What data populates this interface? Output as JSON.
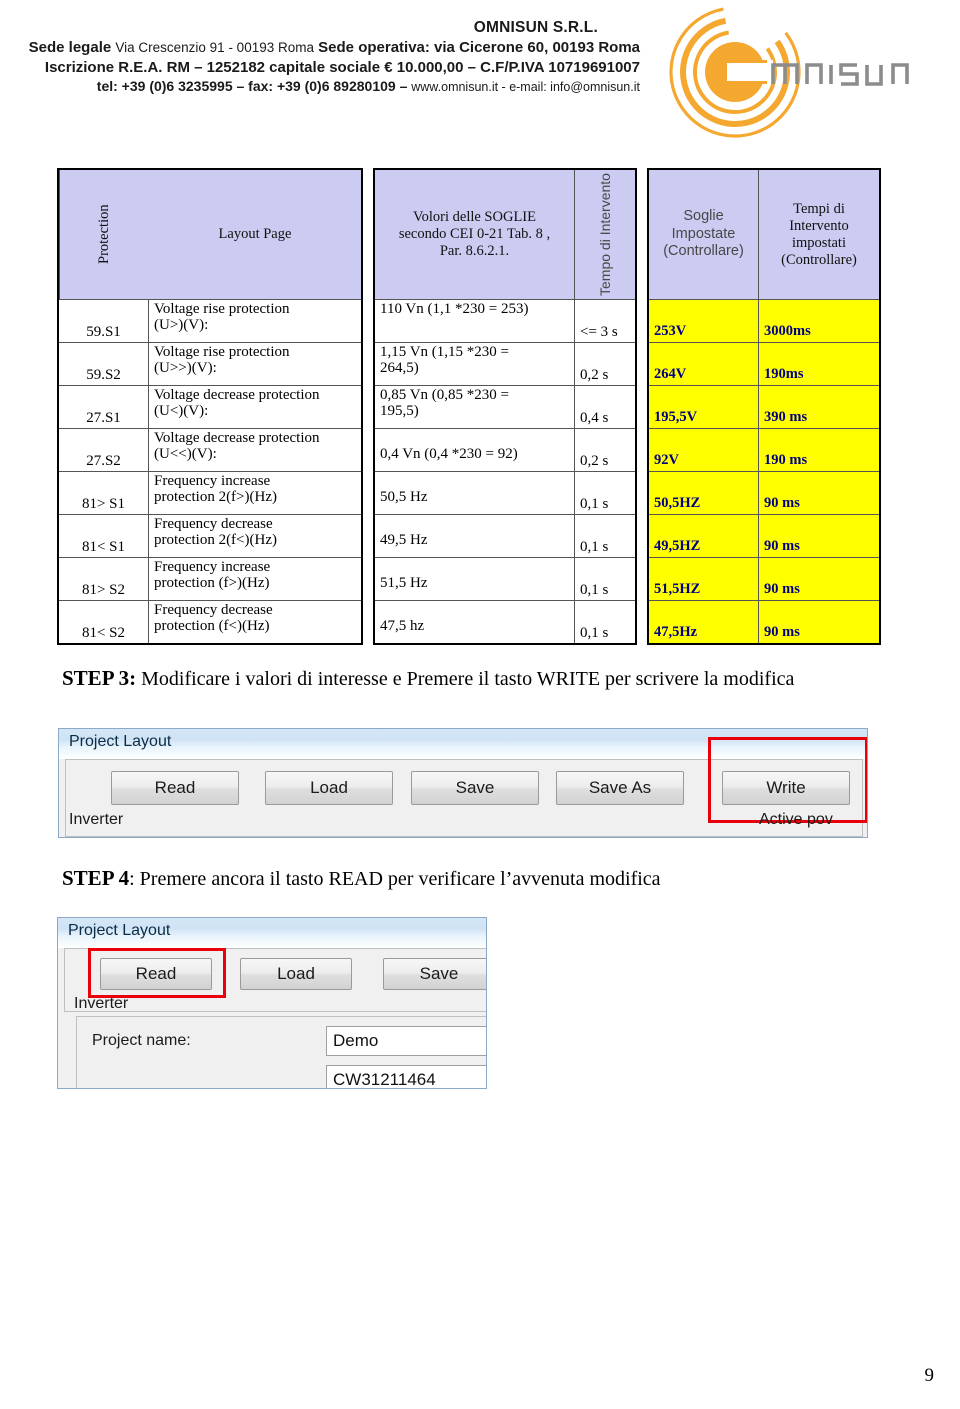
{
  "letterhead": {
    "company": "OMNISUN S.R.L.",
    "line2_bold_a": "Sede legale",
    "line2_thin": "Via Crescenzio 91 - 00193 Roma",
    "line2_bold_b": "Sede operativa: via Cicerone 60, 00193 Roma",
    "line3": "Iscrizione R.E.A. RM – 1252182 capitale sociale € 10.000,00 – C.F/P.IVA  10719691007",
    "line4_bold": "tel: +39 (0)6 3235995 – fax: +39 (0)6 89280109 – ",
    "line4_thin": "www.omnisun.it - e-mail: info@omnisun.it",
    "logo_text": "omnisun",
    "logo_color": "#F5A830",
    "logo_text_color": "#8c8c8c"
  },
  "table": {
    "headers": {
      "protection": "Protection",
      "layout_page": "Layout Page",
      "valori": "Volori delle SOGLIE secondo CEI 0-21 Tab. 8 , Par. 8.6.2.1.",
      "valori_l1": "Volori delle SOGLIE",
      "valori_l2": "secondo CEI 0-21 Tab. 8 ,",
      "valori_l3": "Par. 8.6.2.1.",
      "tempo": "Tempo di Intervento",
      "soglie_l1": "Soglie",
      "soglie_l2": "Impostate",
      "soglie_l3": "(Controllare)",
      "tempi_l1": "Tempi di",
      "tempi_l2": "Intervento",
      "tempi_l3": "impostati",
      "tempi_l4": "(Controllare)"
    },
    "rows": [
      {
        "protection": "59.S1",
        "layout_l1": "Voltage rise protection",
        "layout_l2": "(U>)(V):",
        "value_l1": "110 Vn (1,1 *230 = 253)",
        "value_l2": "",
        "tempo": "<= 3 s",
        "soglia": "253V",
        "tempo_impostato": "3000ms"
      },
      {
        "protection": "59.S2",
        "layout_l1": "Voltage rise protection",
        "layout_l2": "(U>>)(V):",
        "value_l1": "1,15 Vn (1,15 *230 =",
        "value_l2": "264,5)",
        "tempo": "0,2 s",
        "soglia": "264V",
        "tempo_impostato": "190ms"
      },
      {
        "protection": "27.S1",
        "layout_l1": "Voltage decrease protection",
        "layout_l2": "(U<)(V):",
        "value_l1": "0,85 Vn (0,85 *230 =",
        "value_l2": "195,5)",
        "tempo": "0,4 s",
        "soglia": "195,5V",
        "tempo_impostato": "390 ms"
      },
      {
        "protection": "27.S2",
        "layout_l1": "Voltage decrease protection",
        "layout_l2": "(U<<)(V):",
        "value_l1": "",
        "value_l2": "0,4 Vn (0,4 *230 = 92)",
        "tempo": "0,2 s",
        "soglia": "92V",
        "tempo_impostato": "190 ms"
      },
      {
        "protection": "81> S1",
        "layout_l1": "Frequency increase",
        "layout_l2": "protection 2(f>)(Hz)",
        "value_l1": "",
        "value_l2": "50,5 Hz",
        "tempo": "0,1 s",
        "soglia": "50,5HZ",
        "tempo_impostato": "90 ms"
      },
      {
        "protection": "81< S1",
        "layout_l1": "Frequency decrease",
        "layout_l2": "protection 2(f<)(Hz)",
        "value_l1": "",
        "value_l2": "49,5 Hz",
        "tempo": "0,1 s",
        "soglia": "49,5HZ",
        "tempo_impostato": "90 ms"
      },
      {
        "protection": "81> S2",
        "layout_l1": "Frequency increase",
        "layout_l2": "protection (f>)(Hz)",
        "value_l1": "",
        "value_l2": "51,5 Hz",
        "tempo": "0,1 s",
        "soglia": "51,5HZ",
        "tempo_impostato": "90 ms"
      },
      {
        "protection": "81< S2",
        "layout_l1": "Frequency decrease",
        "layout_l2": "protection (f<)(Hz)",
        "value_l1": "",
        "value_l2": "47,5 hz",
        "tempo": "0,1 s",
        "soglia": "47,5Hz",
        "tempo_impostato": "90 ms"
      }
    ],
    "header_bg": "#ccccf2",
    "highlight_bg": "#ffff00",
    "highlight_text": "#000080"
  },
  "step3": {
    "label": "STEP 3:",
    "text": " Modificare i valori di interesse e Premere  il tasto WRITE per scrivere la modifica"
  },
  "step4": {
    "label": "STEP 4",
    "text": ": Premere ancora il tasto READ per verificare l’avvenuta modifica"
  },
  "shot_write": {
    "title": "Project Layout",
    "buttons": [
      "Read",
      "Load",
      "Save",
      "Save As",
      "Write"
    ],
    "highlighted_button": "Write",
    "label_inverter": "Inverter",
    "label_active_power": "Active pov",
    "highlight_color": "#e8000a"
  },
  "shot_read": {
    "title": "Project Layout",
    "buttons": [
      "Read",
      "Load",
      "Save"
    ],
    "highlighted_button": "Read",
    "label_inverter": "Inverter",
    "field_project_name_label": "Project name:",
    "field_project_name_value": "Demo",
    "field_serial_value": "CW31211464",
    "highlight_color": "#e8000a"
  },
  "footer": {
    "page_number": "9"
  }
}
